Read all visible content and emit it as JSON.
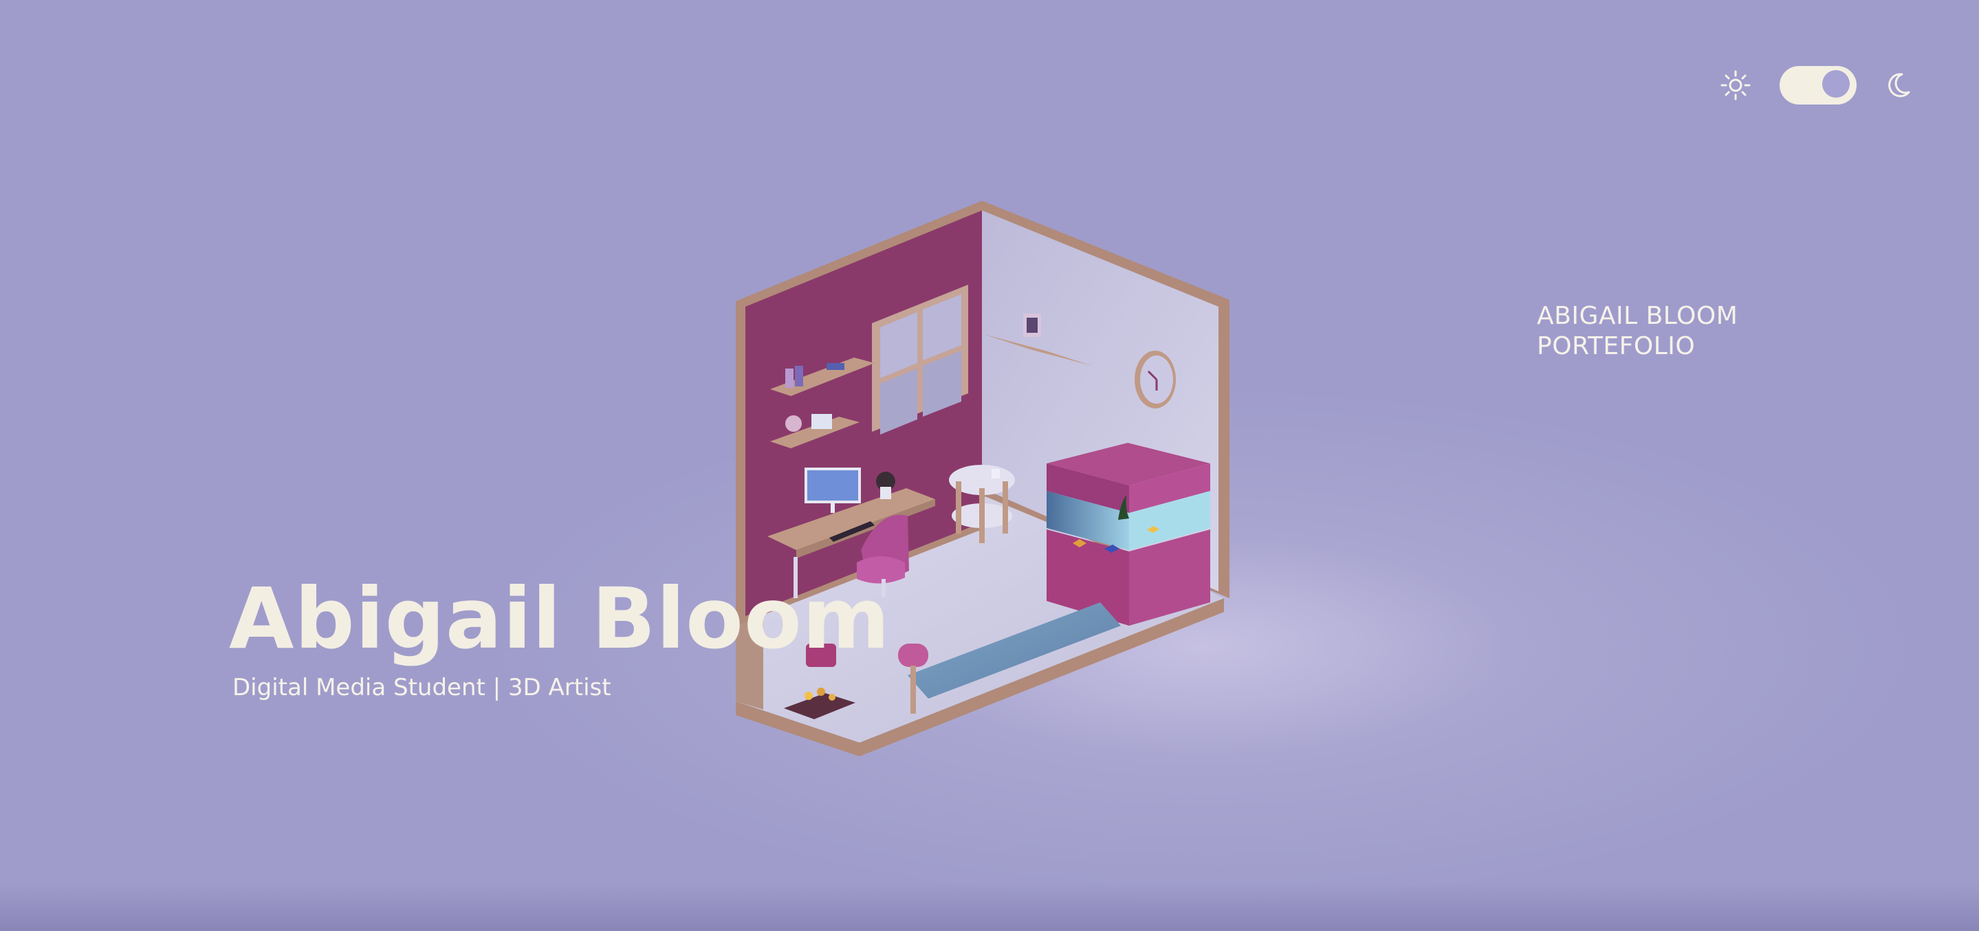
{
  "theme": {
    "background": "#9f9ccb",
    "text_light": "#f3eee2",
    "wall_accent": "#8c3a6c",
    "wood": "#c09a86",
    "toggle_track": "#f3efe2",
    "toggle_knob": "#a6a2d4"
  },
  "header": {
    "sun_icon": "sun-icon",
    "moon_icon": "moon-icon",
    "toggle_state": "light"
  },
  "portfolio_label": {
    "line1": "ABIGAIL BLOOM",
    "line2": "PORTEFOLIO"
  },
  "hero": {
    "name": "Abigail Bloom",
    "subtitle": "Digital Media Student | 3D Artist"
  }
}
